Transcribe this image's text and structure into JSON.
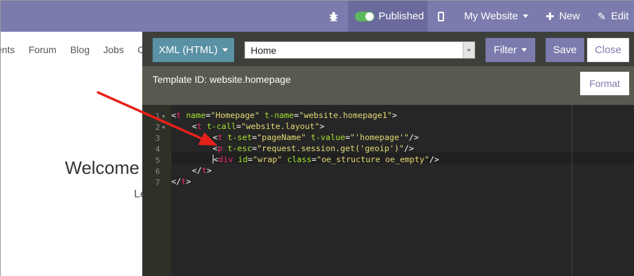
{
  "topbar": {
    "bug_icon": "bug-icon",
    "published_label": "Published",
    "mobile_icon": "mobile-icon",
    "my_website_label": "My Website",
    "new_label": "New",
    "edit_label": "Edit"
  },
  "site": {
    "menu": [
      "ents",
      "Forum",
      "Blog",
      "Jobs",
      "Co"
    ],
    "welcome": "Welcome",
    "sub": "Le"
  },
  "editor": {
    "type_label": "XML (HTML)",
    "view_select": "Home",
    "filter_label": "Filter",
    "save_label": "Save",
    "close_label": "Close",
    "template_id": "Template ID: website.homepage",
    "format_label": "Format",
    "line_numbers": [
      "1",
      "2",
      "3",
      "4",
      "5",
      "6",
      "7"
    ]
  },
  "code": {
    "l1": {
      "tag": "t",
      "a1": "name",
      "v1": "\"Homepage\"",
      "a2": "t-name",
      "v2": "\"website.homepage1\""
    },
    "l2": {
      "tag": "t",
      "a1": "t-call",
      "v1": "\"website.layout\""
    },
    "l3": {
      "tag": "t",
      "a1": "t-set",
      "v1": "\"pageName\"",
      "a2": "t-value",
      "v2": "\"'homepage'\""
    },
    "l4": {
      "tag": "p",
      "a1": "t-esc",
      "v1": "\"request.session.get('geoip')\""
    },
    "l5": {
      "tag": "div",
      "a1": "id",
      "v1": "\"wrap\"",
      "a2": "class",
      "v2": "\"oe_structure oe_empty\""
    },
    "l6": {
      "tag": "t"
    },
    "l7": {
      "tag": "t"
    }
  },
  "colors": {
    "topbar": "#7c7bad",
    "editor_bg": "#262626",
    "annotation_arrow": "#e8201a"
  }
}
